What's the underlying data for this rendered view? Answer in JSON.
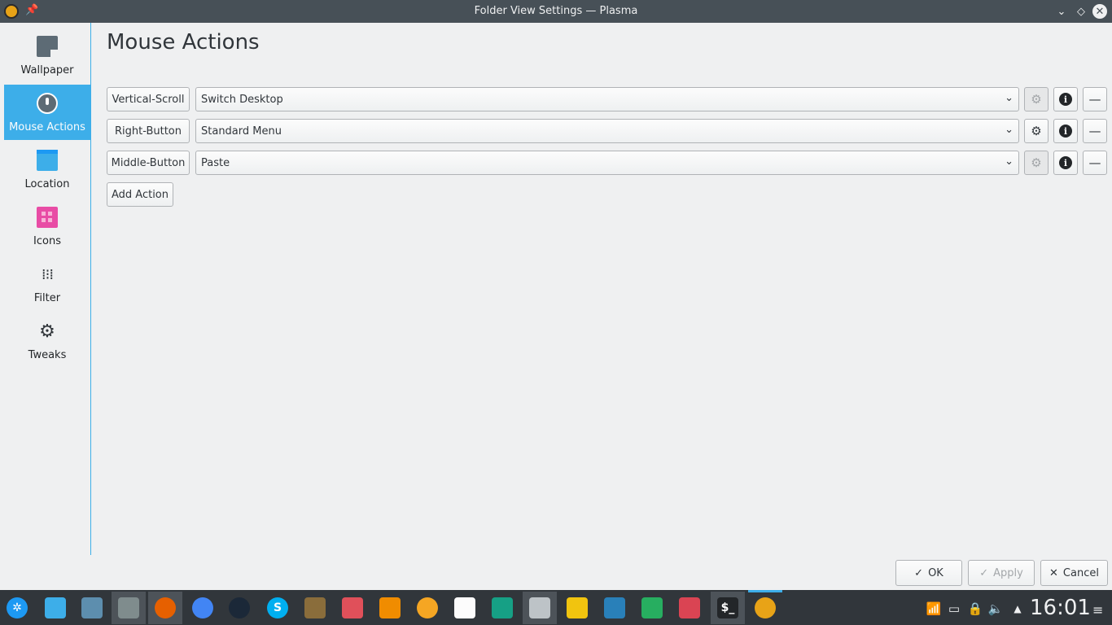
{
  "window": {
    "title": "Folder View Settings — Plasma",
    "pin_glyph": "📌",
    "min_glyph": "⌄",
    "max_glyph": "◇",
    "close_glyph": "✕"
  },
  "sidebar": {
    "items": [
      {
        "label": "Wallpaper",
        "icon": "wallpaper-icon"
      },
      {
        "label": "Mouse Actions",
        "icon": "mouse-icon",
        "active": true
      },
      {
        "label": "Location",
        "icon": "folder-icon"
      },
      {
        "label": "Icons",
        "icon": "icons-grid-icon"
      },
      {
        "label": "Filter",
        "icon": "filter-icon"
      },
      {
        "label": "Tweaks",
        "icon": "gear-icon"
      }
    ],
    "filter_glyph": "⁞⁝⁞",
    "tweaks_glyph": "⚙"
  },
  "main": {
    "title": "Mouse Actions",
    "actions": [
      {
        "trigger": "Vertical-Scroll",
        "plugin": "Switch Desktop",
        "configure_enabled": false
      },
      {
        "trigger": "Right-Button",
        "plugin": "Standard Menu",
        "configure_enabled": true
      },
      {
        "trigger": "Middle-Button",
        "plugin": "Paste",
        "configure_enabled": false
      }
    ],
    "add_action_label": "Add Action",
    "chevron_glyph": "⌄",
    "gear_glyph": "⚙",
    "info_glyph": "i",
    "remove_glyph": "—"
  },
  "dialog": {
    "ok_label": "OK",
    "apply_label": "Apply",
    "cancel_label": "Cancel",
    "check_glyph": "✓",
    "cancel_glyph": "✕"
  },
  "taskbar": {
    "launchers": [
      {
        "name": "kde-menu",
        "color": "#1d99f3",
        "glyph": "✲"
      },
      {
        "name": "desktop",
        "color": "#3daee9",
        "glyph": ""
      },
      {
        "name": "screenshot",
        "color": "#5d8eae",
        "glyph": ""
      },
      {
        "name": "file-manager",
        "color": "#7f8c8d",
        "glyph": "",
        "active": true
      },
      {
        "name": "firefox",
        "color": "#e66000",
        "glyph": "",
        "active": true
      },
      {
        "name": "chrome",
        "color": "#4285f4",
        "glyph": ""
      },
      {
        "name": "steam",
        "color": "#1b2838",
        "glyph": ""
      },
      {
        "name": "skype",
        "color": "#00aff0",
        "glyph": "S"
      },
      {
        "name": "gimp",
        "color": "#8a6d3b",
        "glyph": ""
      },
      {
        "name": "photo-app",
        "color": "#e0505a",
        "glyph": ""
      },
      {
        "name": "vlc",
        "color": "#f08c00",
        "glyph": ""
      },
      {
        "name": "mango",
        "color": "#f5a623",
        "glyph": ""
      },
      {
        "name": "document",
        "color": "#fcfcfc",
        "glyph": ""
      },
      {
        "name": "notes",
        "color": "#16a085",
        "glyph": ""
      },
      {
        "name": "editor",
        "color": "#bdc3c7",
        "glyph": "",
        "active": true
      },
      {
        "name": "network",
        "color": "#f1c40f",
        "glyph": ""
      },
      {
        "name": "monitor",
        "color": "#2980b9",
        "glyph": ""
      },
      {
        "name": "charts",
        "color": "#27ae60",
        "glyph": ""
      },
      {
        "name": "mixer",
        "color": "#da4453",
        "glyph": ""
      },
      {
        "name": "terminal",
        "color": "#232629",
        "glyph": "$_",
        "active": true
      },
      {
        "name": "app-current",
        "color": "#e8a317",
        "glyph": "",
        "running": true
      }
    ],
    "tray": {
      "wifi_glyph": "📶",
      "battery_glyph": "▭",
      "lock_glyph": "🔒",
      "volume_glyph": "🔈",
      "expand_glyph": "▲"
    },
    "clock": "16:01",
    "menu_glyph": "≡"
  }
}
